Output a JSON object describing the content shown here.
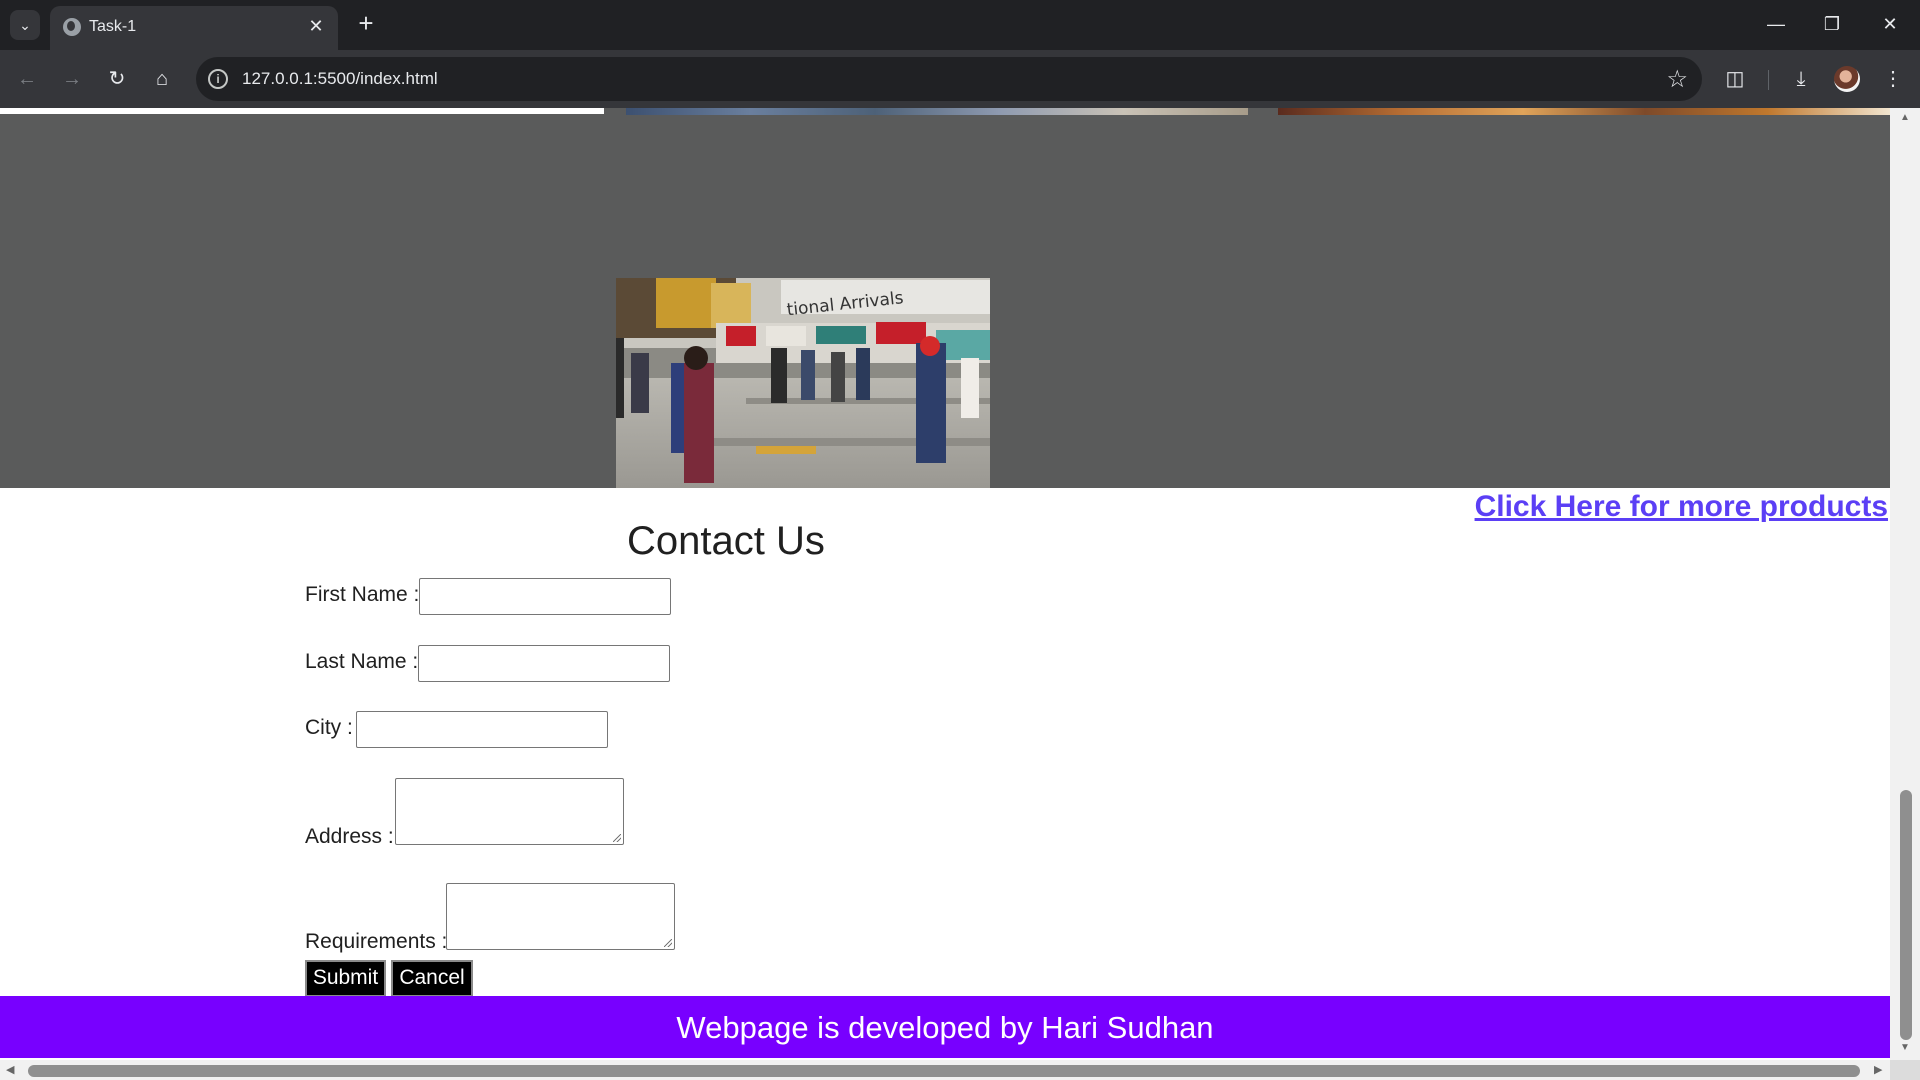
{
  "browser": {
    "tab_title": "Task-1",
    "url": "127.0.0.1:5500/index.html",
    "icons": {
      "tab_search": "chevron-down-icon",
      "tab_close": "close-icon",
      "new_tab": "plus-icon",
      "back": "back-arrow-icon",
      "forward": "forward-arrow-icon",
      "reload": "reload-icon",
      "home": "home-icon",
      "site_info": "info-icon",
      "bookmark": "star-icon",
      "extensions": "puzzle-icon",
      "downloads": "download-icon",
      "menu": "kebab-menu-icon"
    }
  },
  "page": {
    "more_products_link": "Click Here for more products",
    "contact": {
      "title": "Contact Us",
      "first_name_label": "First Name :",
      "first_name_value": "",
      "last_name_label": "Last Name :",
      "last_name_value": "",
      "city_label": "City :",
      "city_value": "",
      "address_label": "Address :",
      "address_value": "",
      "requirements_label": "Requirements :",
      "requirements_value": "",
      "submit_label": "Submit",
      "cancel_label": "Cancel"
    },
    "footer_text": "Webpage is developed by Hari Sudhan",
    "photo_sign_text": "tional Arrivals"
  },
  "colors": {
    "gallery_bg": "#5a5b5b",
    "link": "#5b3ff5",
    "footer_bg": "#7800ff",
    "button_bg": "#000000"
  }
}
